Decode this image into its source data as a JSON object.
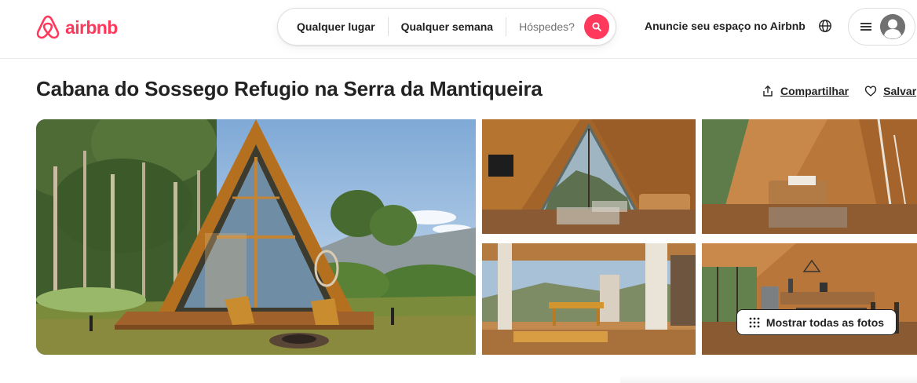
{
  "header": {
    "logo_text": "airbnb",
    "logo_icon": "airbnb-belo-icon",
    "search": {
      "where": "Qualquer lugar",
      "when": "Qualquer semana",
      "guests": "Hóspedes?",
      "search_icon": "search-icon"
    },
    "host_link": "Anuncie seu espaço no Airbnb",
    "globe_icon": "globe-icon",
    "menu_icon": "hamburger-menu-icon",
    "avatar_icon": "user-avatar-icon"
  },
  "listing": {
    "title": "Cabana do Sossego Refugio na Serra da Mantiqueira",
    "share_label": "Compartilhar",
    "save_label": "Salvar",
    "share_icon": "share-icon",
    "save_icon": "heart-icon"
  },
  "gallery": {
    "show_all_label": "Mostrar todas as fotos",
    "show_all_icon": "grid-dots-icon"
  },
  "colors": {
    "brand": "#ff385c",
    "text": "#222222",
    "muted": "#717171",
    "border": "#dddddd"
  }
}
